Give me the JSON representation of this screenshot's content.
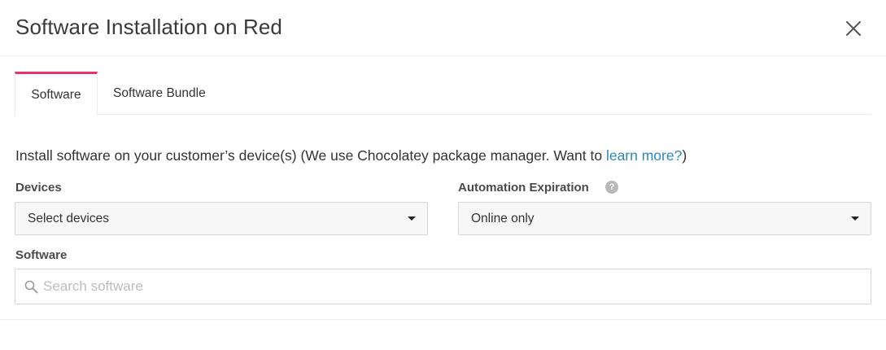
{
  "modal": {
    "title": "Software Installation on Red",
    "close_icon": "close-icon"
  },
  "tabs": [
    {
      "label": "Software",
      "active": true
    },
    {
      "label": "Software Bundle",
      "active": false
    }
  ],
  "intro": {
    "text": "Install software on your customer’s device(s) (We use Chocolatey package manager. Want to ",
    "link": "learn more?",
    "suffix": ")"
  },
  "devices": {
    "label": "Devices",
    "value": "Select devices"
  },
  "automation": {
    "label": "Automation Expiration",
    "help": "?",
    "value": "Online only"
  },
  "software": {
    "label": "Software",
    "placeholder": "Search software"
  },
  "colors": {
    "accent": "#e8336c",
    "link": "#2b8ab8"
  }
}
